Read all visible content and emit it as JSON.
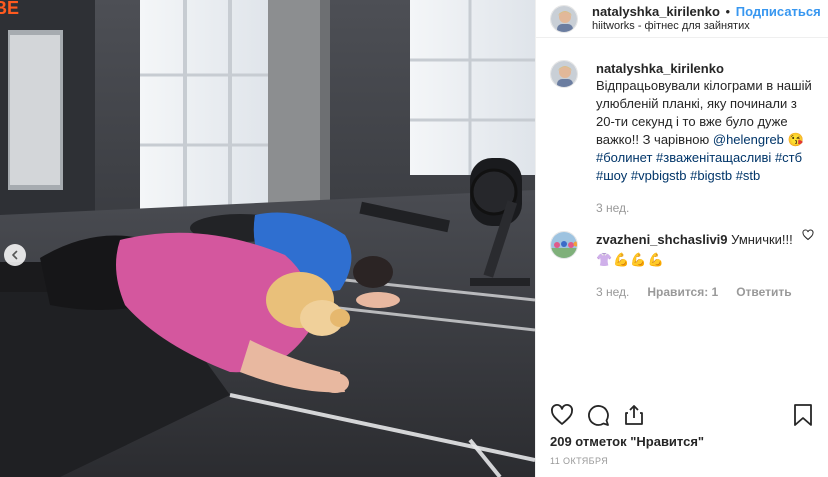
{
  "photo": {
    "neon_text": "BE",
    "description_alt": ""
  },
  "header": {
    "username": "natalyshka_kirilenko",
    "separator": "•",
    "follow_label": "Подписаться",
    "location": "hiitworks - фітнес для зайнятих"
  },
  "caption": {
    "username": "natalyshka_kirilenko",
    "text": "Відпрацьовували кілограми в нашій улюбленій планкі, яку починали з 20-ти секунд і то вже було дуже важко!! З чарівною",
    "mention": "@helengreb",
    "emoji": "😘",
    "hashtags": [
      "#болинет",
      "#зваженітащасливі",
      "#стб",
      "#шоу",
      "#vpbigstb",
      "#bigstb",
      "#stb"
    ],
    "time": "3 нед."
  },
  "comment": {
    "username": "zvazheni_shchaslivi9",
    "text": "Умнички!!!",
    "emojis": [
      "👚",
      "💪",
      "💪",
      "💪"
    ],
    "time": "3 нед.",
    "likes_label": "Нравится: 1",
    "reply_label": "Ответить"
  },
  "footer": {
    "likes": "209 отметок \"Нравится\"",
    "date": "11 ОКТЯБРЯ"
  },
  "colors": {
    "link_blue": "#3897f0",
    "hashtag_blue": "#003569",
    "muted": "#999999",
    "text": "#262626",
    "pink_shirt": "#d4579e",
    "blue_shirt": "#2f6fd0"
  },
  "icons": {
    "like": "heart-icon",
    "comment": "comment-icon",
    "share": "share-icon",
    "save": "bookmark-icon",
    "prev": "chevron-left-icon"
  }
}
